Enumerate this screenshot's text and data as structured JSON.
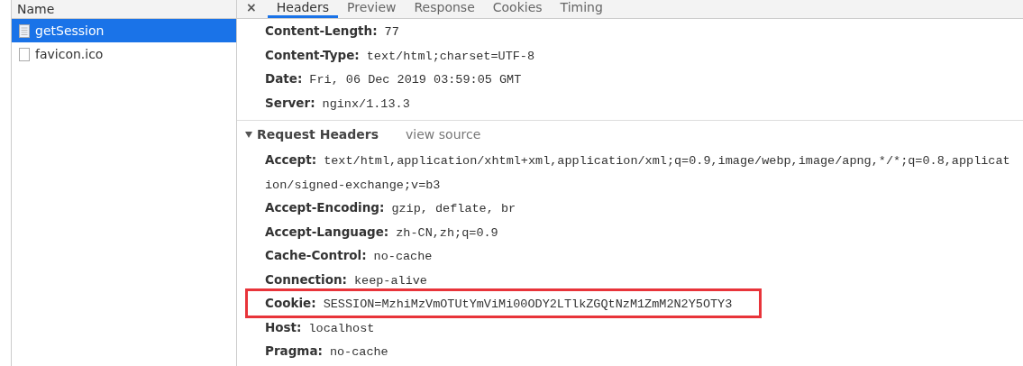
{
  "requests_panel": {
    "column_header": "Name",
    "items": [
      {
        "name": "getSession",
        "selected": true
      },
      {
        "name": "favicon.ico",
        "selected": false
      }
    ]
  },
  "detail_tabs": {
    "close": "×",
    "tabs": [
      {
        "label": "Headers",
        "selected": true
      },
      {
        "label": "Preview",
        "selected": false
      },
      {
        "label": "Response",
        "selected": false
      },
      {
        "label": "Cookies",
        "selected": false
      },
      {
        "label": "Timing",
        "selected": false
      }
    ]
  },
  "response_headers": [
    {
      "key": "Content-Length:",
      "value": "77",
      "highlighted": false
    },
    {
      "key": "Content-Type:",
      "value": "text/html;charset=UTF-8",
      "highlighted": false
    },
    {
      "key": "Date:",
      "value": "Fri, 06 Dec 2019 03:59:05 GMT",
      "highlighted": false
    },
    {
      "key": "Server:",
      "value": "nginx/1.13.3",
      "highlighted": false
    }
  ],
  "request_headers": {
    "title": "Request Headers",
    "expanded": true,
    "view_source": "view source",
    "headers": [
      {
        "key": "Accept:",
        "value": "text/html,application/xhtml+xml,application/xml;q=0.9,image/webp,image/apng,*/*;q=0.8,application/signed-exchange;v=b3",
        "highlighted": false
      },
      {
        "key": "Accept-Encoding:",
        "value": "gzip, deflate, br",
        "highlighted": false
      },
      {
        "key": "Accept-Language:",
        "value": "zh-CN,zh;q=0.9",
        "highlighted": false
      },
      {
        "key": "Cache-Control:",
        "value": "no-cache",
        "highlighted": false
      },
      {
        "key": "Connection:",
        "value": "keep-alive",
        "highlighted": false
      },
      {
        "key": "Cookie:",
        "value": "SESSION=MzhiMzVmOTUtYmViMi00ODY2LTlkZGQtNzM1ZmM2N2Y5OTY3",
        "highlighted": true
      },
      {
        "key": "Host:",
        "value": "localhost",
        "highlighted": false
      },
      {
        "key": "Pragma:",
        "value": "no-cache",
        "highlighted": false
      }
    ]
  }
}
